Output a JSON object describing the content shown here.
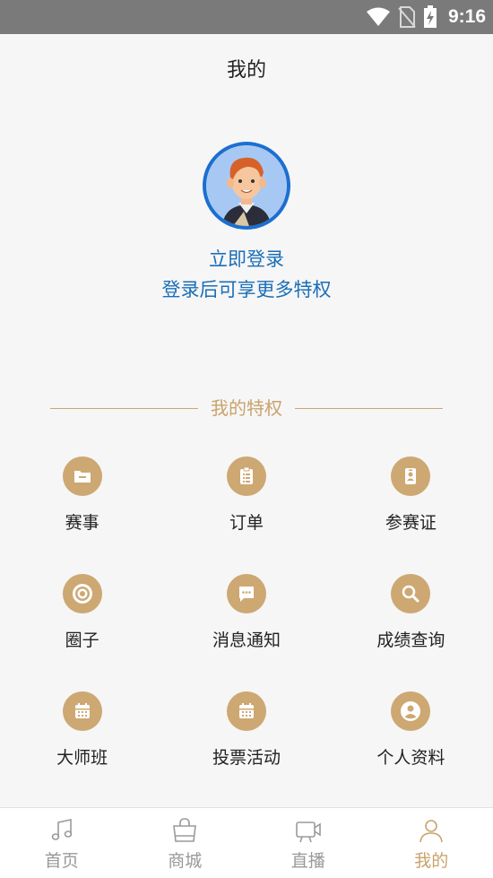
{
  "status": {
    "time": "9:16"
  },
  "page": {
    "title": "我的"
  },
  "profile": {
    "login_label": "立即登录",
    "login_sub": "登录后可享更多特权"
  },
  "privileges": {
    "title": "我的特权",
    "items": [
      {
        "label": "赛事",
        "icon": "folder-icon"
      },
      {
        "label": "订单",
        "icon": "clipboard-icon"
      },
      {
        "label": "参赛证",
        "icon": "badge-icon"
      },
      {
        "label": "圈子",
        "icon": "target-icon"
      },
      {
        "label": "消息通知",
        "icon": "message-icon"
      },
      {
        "label": "成绩查询",
        "icon": "search-icon"
      },
      {
        "label": "大师班",
        "icon": "calendar-icon"
      },
      {
        "label": "投票活动",
        "icon": "calendar-icon"
      },
      {
        "label": "个人资料",
        "icon": "user-icon"
      }
    ]
  },
  "tabs": [
    {
      "label": "首页",
      "icon": "music-note-icon",
      "active": false
    },
    {
      "label": "商城",
      "icon": "shopping-bag-icon",
      "active": false
    },
    {
      "label": "直播",
      "icon": "video-camera-icon",
      "active": false
    },
    {
      "label": "我的",
      "icon": "person-icon",
      "active": true
    }
  ],
  "colors": {
    "accent": "#c9a36b",
    "link": "#1b6fb8",
    "status_bar": "#7a7a7a"
  }
}
